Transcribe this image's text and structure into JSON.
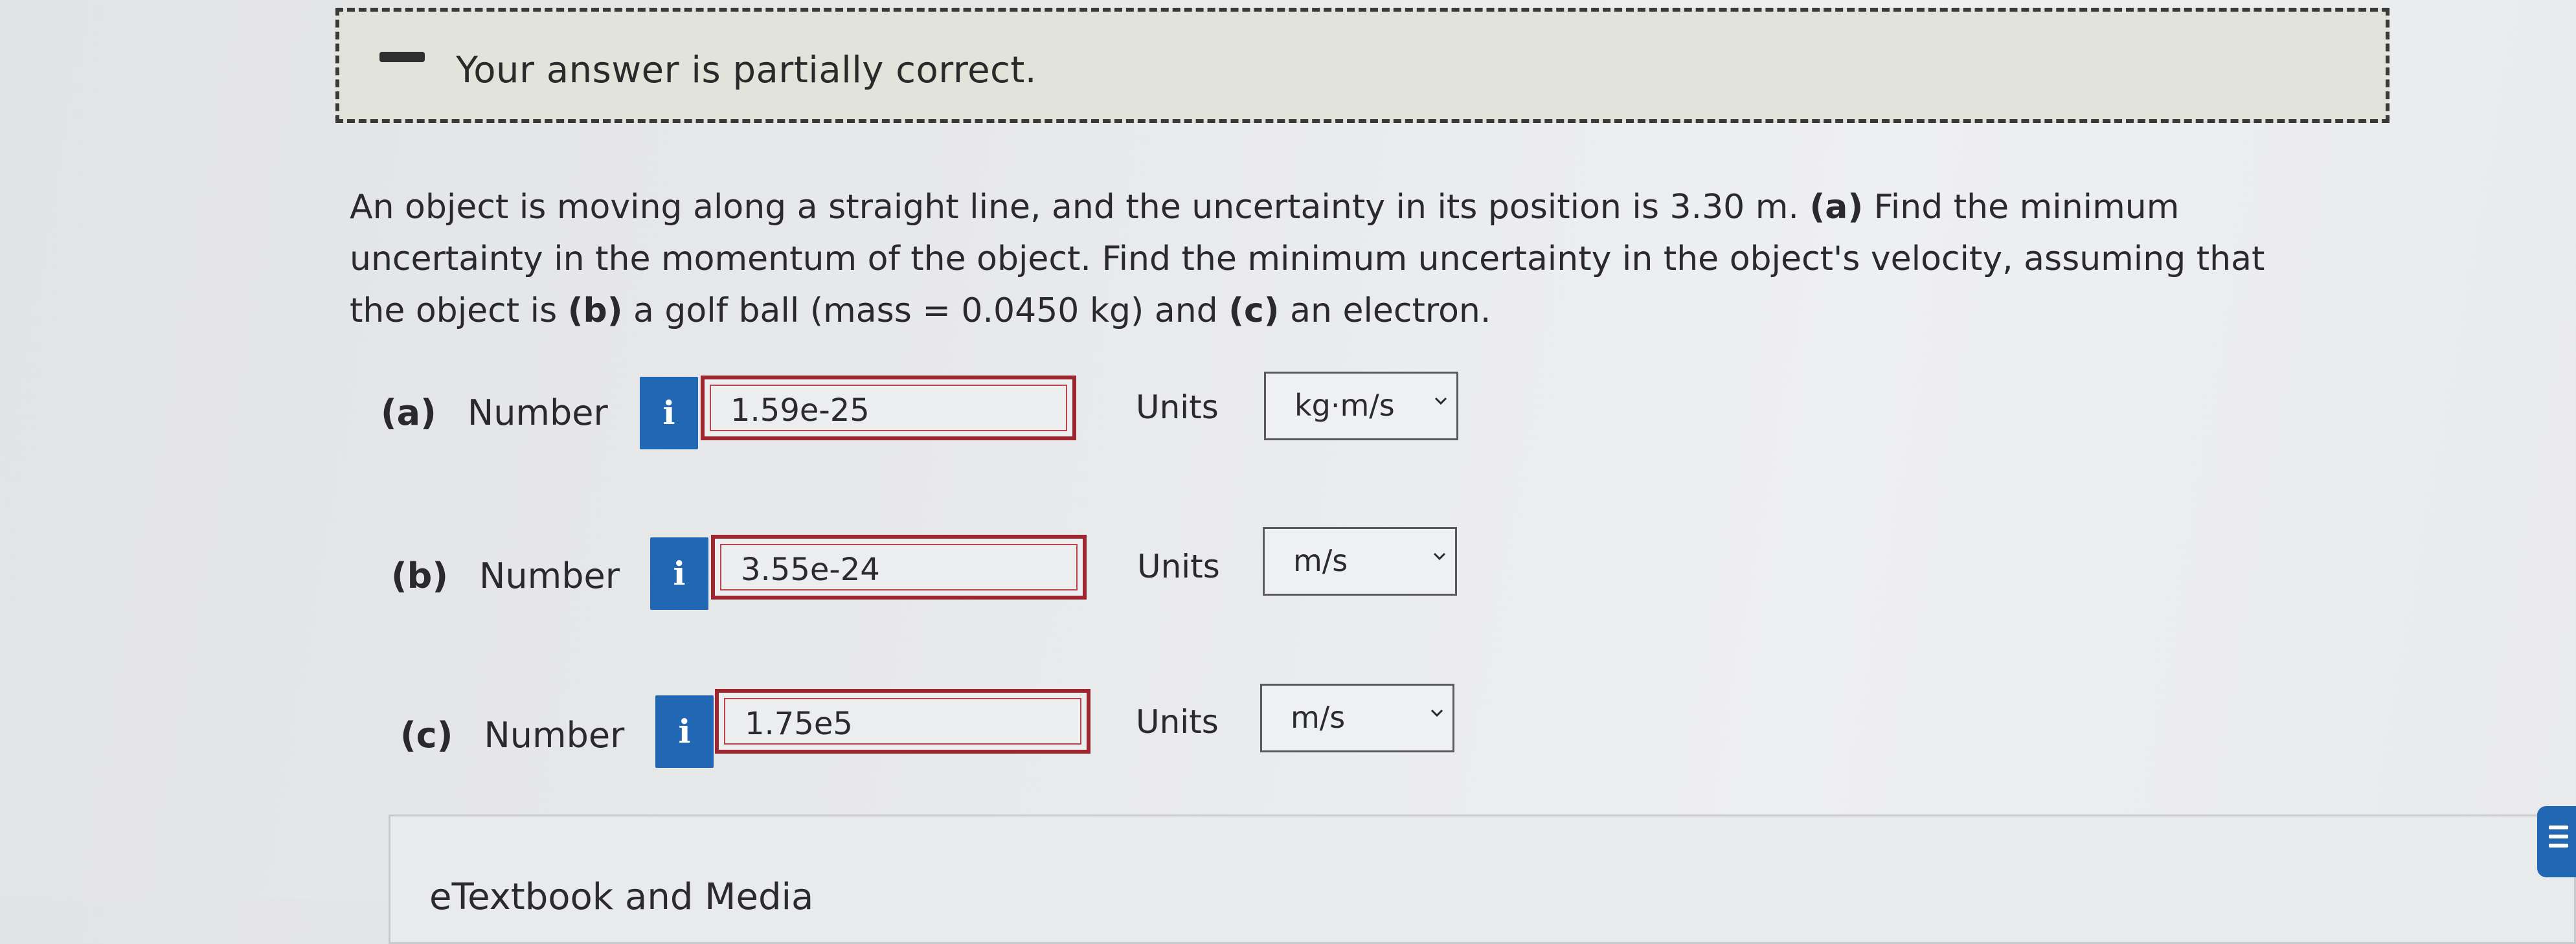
{
  "feedback": {
    "message": "Your answer is partially correct."
  },
  "question": {
    "part1": "An object is moving along a straight line, and the uncertainty in its position is 3.30 m.",
    "a_tag": "(a)",
    "part2": "Find the minimum uncertainty in the momentum of the object. Find the minimum uncertainty in the object's velocity, assuming that the object is",
    "b_tag": "(b)",
    "part3": "a golf ball (mass = 0.0450 kg) and",
    "c_tag": "(c)",
    "part4": "an electron."
  },
  "answers": [
    {
      "part": "(a)",
      "label": "Number",
      "info": "i",
      "value": "1.59e-25",
      "units_label": "Units",
      "units": "kg·m/s"
    },
    {
      "part": "(b)",
      "label": "Number",
      "info": "i",
      "value": "3.55e-24",
      "units_label": "Units",
      "units": "m/s"
    },
    {
      "part": "(c)",
      "label": "Number",
      "info": "i",
      "value": "1.75e5",
      "units_label": "Units",
      "units": "m/s"
    }
  ],
  "resources": {
    "label": "eTextbook and Media"
  },
  "colors": {
    "accent": "#2167b3",
    "incorrect_border": "#9c2730"
  },
  "icons": {
    "feedback": "partial-correct-dash-icon",
    "info": "info-icon",
    "dropdown": "chevron-down-icon",
    "side_tab": "menu-lines-icon"
  }
}
